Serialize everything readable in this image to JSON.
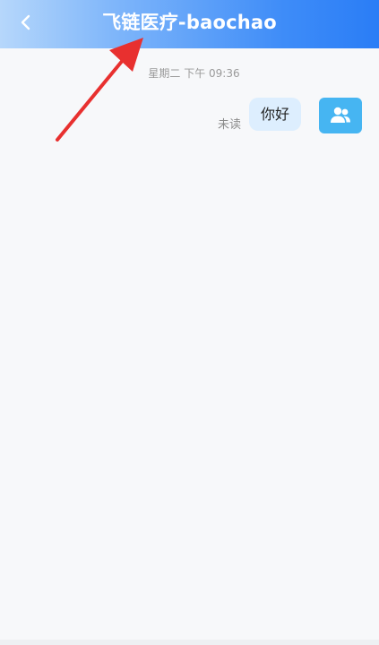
{
  "header": {
    "back_icon": "chevron-left-icon",
    "title": "飞链医疗-baochao"
  },
  "chat": {
    "timestamp": "星期二 下午 09:36",
    "messages": [
      {
        "text": "你好",
        "status": "未读",
        "sender_avatar_icon": "user-group-icon"
      }
    ]
  },
  "colors": {
    "header_gradient_start": "#b6d7fb",
    "header_gradient_end": "#2a7df6",
    "bubble_bg": "#ddeefe",
    "avatar_bg": "#46b5f2",
    "annotation_arrow": "#e8302f"
  }
}
